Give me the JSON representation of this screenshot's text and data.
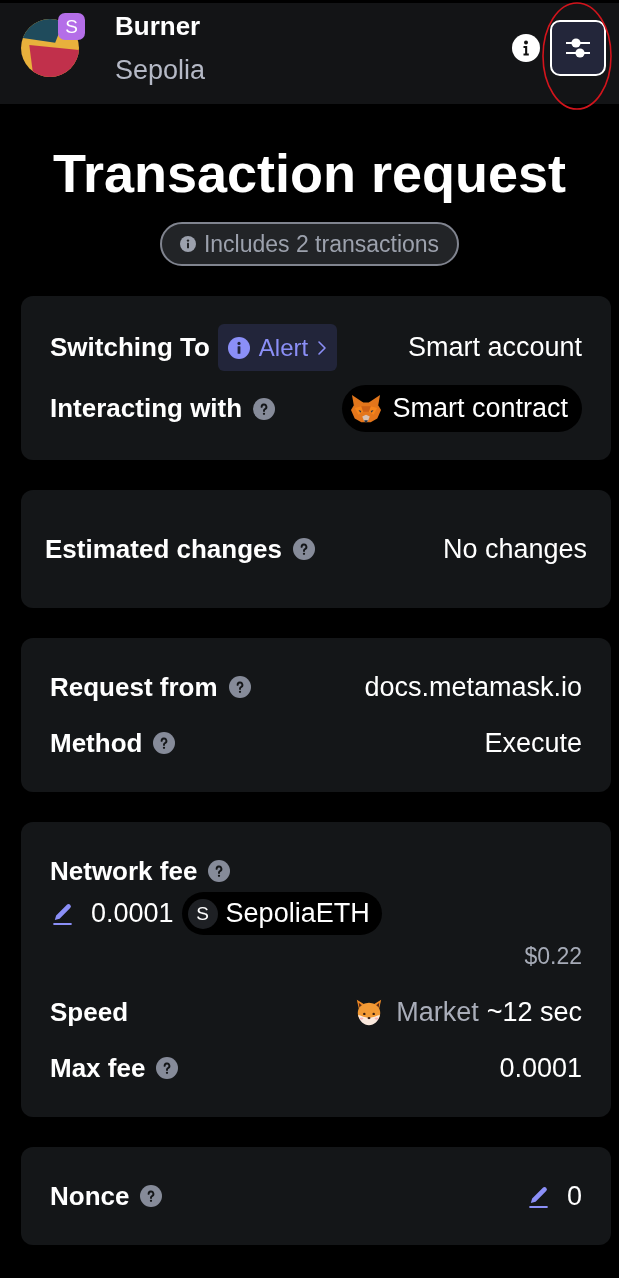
{
  "header": {
    "account_name": "Burner",
    "network_badge": "S",
    "network": "Sepolia",
    "settings_button": {
      "circled": true
    }
  },
  "title": "Transaction request",
  "batch_badge": "Includes 2 transactions",
  "sections": [
    {
      "kind": "details",
      "rows": [
        {
          "kind": "alert",
          "label": "Switching To",
          "help": false,
          "alert": "Alert",
          "value": "Smart account"
        },
        {
          "kind": "contract",
          "label": "Interacting with",
          "help": true,
          "value": "Smart contract"
        }
      ]
    },
    {
      "kind": "simulation",
      "rows": [
        {
          "kind": "text",
          "label": "Estimated changes",
          "help": true,
          "value": "No changes"
        }
      ]
    },
    {
      "kind": "details",
      "rows": [
        {
          "kind": "text",
          "label": "Request from",
          "help": true,
          "value": "docs.metamask.io"
        },
        {
          "kind": "text",
          "label": "Method",
          "help": true,
          "value": "Execute"
        }
      ]
    },
    {
      "kind": "details",
      "rows": [
        {
          "kind": "fee",
          "label": "Network fee",
          "help": true,
          "amount": "0.0001",
          "token_badge": "S",
          "token": "SepoliaETH",
          "fiat": "$0.22"
        },
        {
          "kind": "speed",
          "label": "Speed",
          "help": false,
          "speed": "Market",
          "value": "~12 sec"
        },
        {
          "kind": "text",
          "label": "Max fee",
          "help": true,
          "value": "0.0001"
        }
      ]
    },
    {
      "kind": "details",
      "rows": [
        {
          "kind": "edit",
          "label": "Nonce",
          "help": true,
          "value": "0"
        }
      ]
    }
  ]
}
